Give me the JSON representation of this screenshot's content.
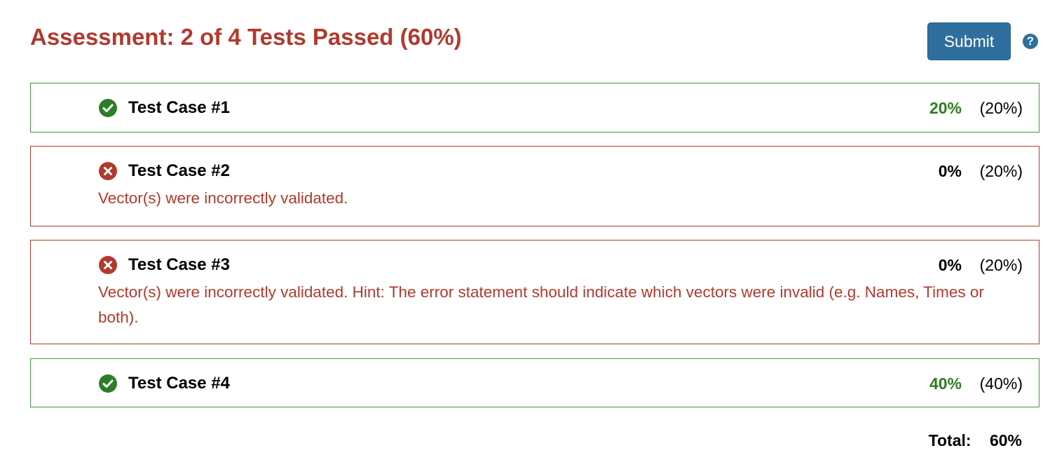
{
  "header": {
    "title": "Assessment: 2 of 4 Tests Passed (60%)",
    "submit_label": "Submit",
    "help_glyph": "?"
  },
  "colors": {
    "fail_red": "#b03a2e",
    "pass_green": "#3f9a3a",
    "score_green": "#2e7d1f",
    "button_blue": "#2f6f9f"
  },
  "test_cases": [
    {
      "name": "Test Case #1",
      "status": "pass",
      "icon": "check-circle-icon",
      "score": "20%",
      "weight": "(20%)",
      "message": ""
    },
    {
      "name": "Test Case #2",
      "status": "fail",
      "icon": "x-circle-icon",
      "score": "0%",
      "weight": "(20%)",
      "message": "Vector(s) were incorrectly validated."
    },
    {
      "name": "Test Case #3",
      "status": "fail",
      "icon": "x-circle-icon",
      "score": "0%",
      "weight": "(20%)",
      "message": "Vector(s) were incorrectly validated. Hint: The error statement should indicate which vectors were invalid (e.g. Names, Times or both)."
    },
    {
      "name": "Test Case #4",
      "status": "pass",
      "icon": "check-circle-icon",
      "score": "40%",
      "weight": "(40%)",
      "message": ""
    }
  ],
  "total": {
    "label": "Total:",
    "value": "60%"
  }
}
